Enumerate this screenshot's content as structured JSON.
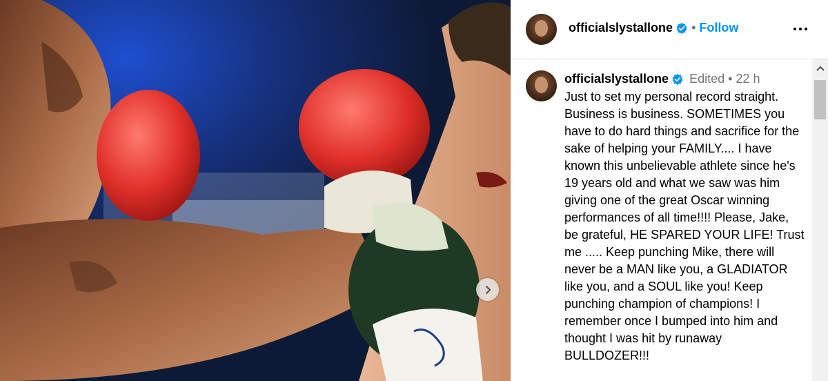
{
  "post": {
    "username": "officialslystallone",
    "follow_label": "Follow",
    "dot_separator": "•",
    "more_icon": "more-horizontal-icon",
    "verified_color": "#0095f6"
  },
  "media": {
    "description_icon": "photo-boxing",
    "next_icon": "chevron-right-icon"
  },
  "comment": {
    "username": "officialslystallone",
    "edited_label": "Edited",
    "dot_separator": "•",
    "timestamp": "22 h",
    "text": "Just to set my personal record straight. Business is business. SOMETIMES you have to do hard things and sacrifice for the sake of helping your FAMILY.... I have known this unbelievable athlete since he's 19 years old and what we saw was him giving one of the great Oscar winning performances of all time!!!! Please, Jake, be grateful, HE SPARED YOUR LIFE! Trust me ..... Keep punching Mike, there will never be a MAN like you, a GLADIATOR like you, and a SOUL like you! Keep punching champion of champions! I remember once I bumped into him and thought I was hit by runaway BULLDOZER!!!"
  },
  "colors": {
    "link": "#0095f6",
    "muted": "#737373",
    "border": "#dbdbdb"
  }
}
